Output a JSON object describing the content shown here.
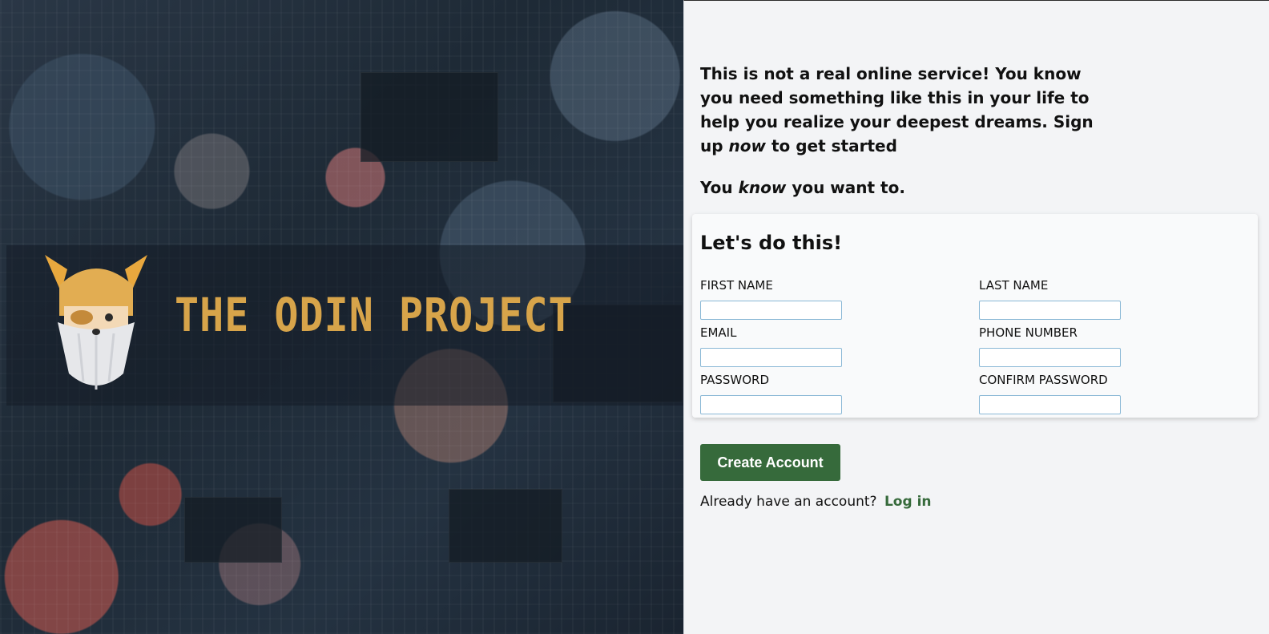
{
  "brand": {
    "name": "THE ODIN PROJECT",
    "logo_icon": "odin-viking-head-icon",
    "accent_color": "#d7a44a"
  },
  "intro": {
    "line_a": "This is not a real online service! You know you need something like this in your life to help you realize your deepest dreams. Sign up ",
    "line_a_emph": "now",
    "line_a_end": " to get started",
    "line_b_start": "You ",
    "line_b_emph": "know",
    "line_b_end": " you want to."
  },
  "form": {
    "title": "Let's do this!",
    "fields": {
      "first_name": {
        "label": "FIRST NAME",
        "value": ""
      },
      "last_name": {
        "label": "LAST NAME",
        "value": ""
      },
      "email": {
        "label": "EMAIL",
        "value": ""
      },
      "phone": {
        "label": "PHONE NUMBER",
        "value": ""
      },
      "password": {
        "label": "PASSWORD",
        "value": ""
      },
      "confirm_password": {
        "label": "CONFIRM PASSWORD",
        "value": ""
      }
    }
  },
  "actions": {
    "create_label": "Create Account",
    "create_color": "#366a3b",
    "login_prompt": "Already have an account?",
    "login_label": "Log in"
  }
}
